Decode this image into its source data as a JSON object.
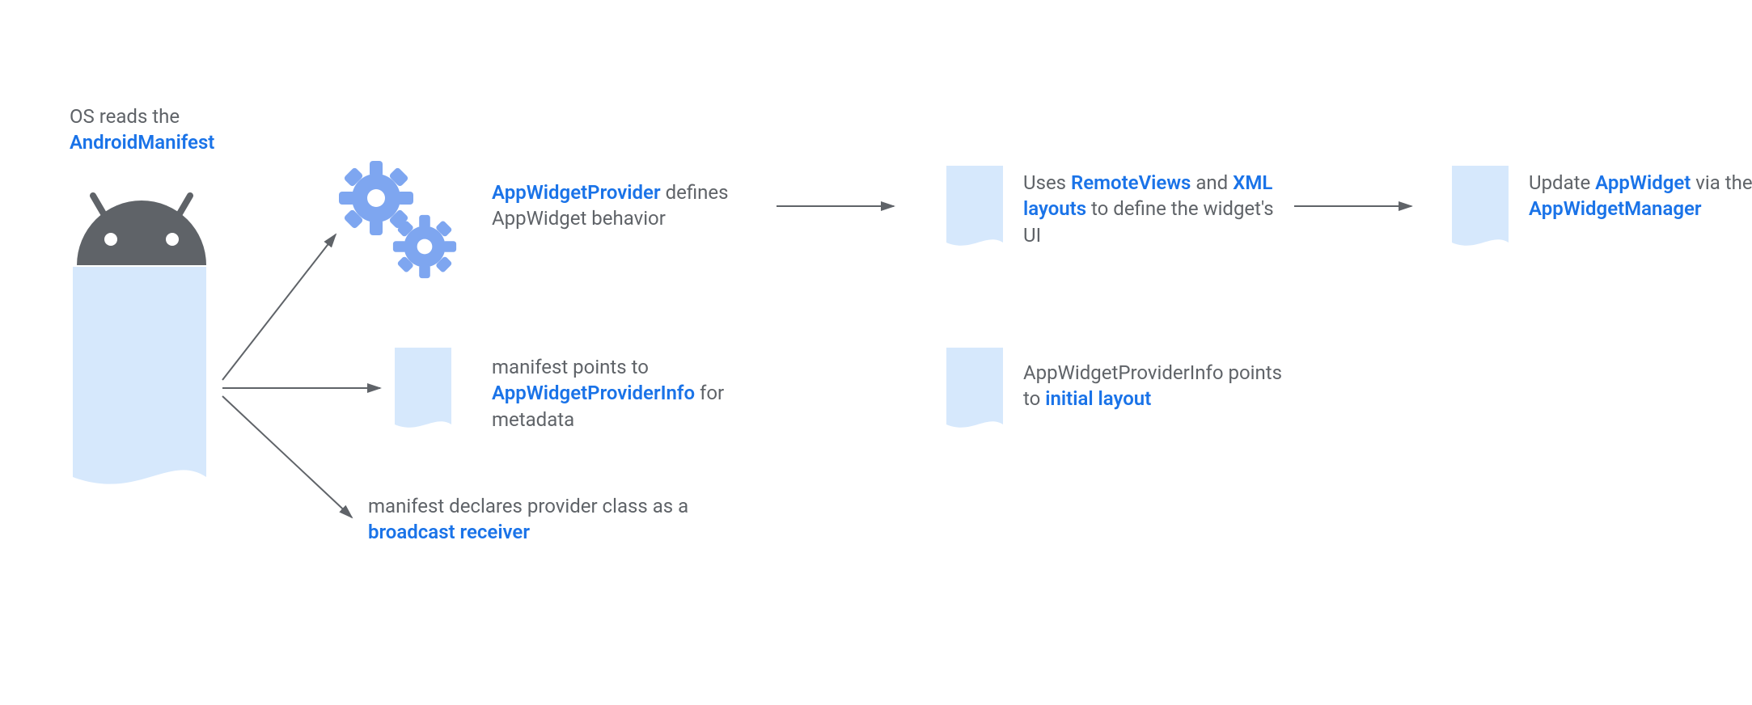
{
  "colors": {
    "blue": "#1a73e8",
    "lightblue": "#d6e8fc",
    "midblue": "#7ea6f0",
    "gray_text": "#5f6368",
    "arrow_gray": "#5f6368",
    "android_head": "#5f6368"
  },
  "intro": {
    "line1": "OS reads the",
    "line2": "AndroidManifest"
  },
  "node_provider": {
    "part1": "AppWidgetProvider",
    "part2": "defines AppWidget behavior"
  },
  "node_remoteviews": {
    "pre": "Uses ",
    "rv": "RemoteViews",
    "mid": " and ",
    "xml": "XML layouts",
    "post": " to define the widget's UI"
  },
  "node_update": {
    "pre": "Update ",
    "aw": "AppWidget",
    "mid": " via the ",
    "mgr": "AppWidgetManager"
  },
  "node_metadata": {
    "pre": "manifest points to ",
    "info": "AppWidgetProviderInfo",
    "post": " for metadata"
  },
  "node_initial": {
    "pre": "AppWidgetProviderInfo points to ",
    "il": "initial layout"
  },
  "node_broadcast": {
    "pre": "manifest declares provider class as a ",
    "br": "broadcast receiver"
  }
}
